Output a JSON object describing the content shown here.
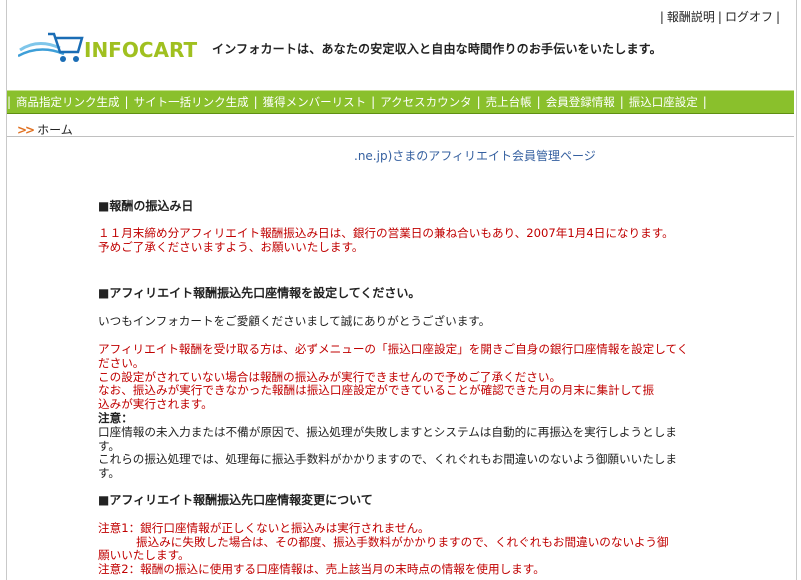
{
  "topnav": {
    "help": "報酬説明",
    "logout": "ログオフ"
  },
  "logo": {
    "text": "INFOCART"
  },
  "tagline": "インフォカートは、あなたの安定収入と自由な時間作りのお手伝いをいたします。",
  "menu": [
    "商品指定リンク生成",
    "サイト一括リンク生成",
    "獲得メンバーリスト",
    "アクセスカウンタ",
    "売上台帳",
    "会員登録情報",
    "振込口座設定"
  ],
  "breadcrumb": {
    "home": "ホーム"
  },
  "member_title": ".ne.jp)さまのアフィリエイト会員管理ページ",
  "section1": {
    "heading": "■報酬の振込み日",
    "line1": "１１月末締め分アフィリエイト報酬振込み日は、銀行の営業日の兼ね合いもあり、2007年1月4日になります。",
    "line2": "予めご了承くださいますよう、お願いいたします。"
  },
  "section2": {
    "heading": "■アフィリエイト報酬振込先口座情報を設定してください。",
    "greeting": "いつもインフォカートをご愛顧くださいまして誠にありがとうございます。",
    "red1": "アフィリエイト報酬を受け取る方は、必ずメニューの「振込口座設定」を開きご自身の銀行口座情報を設定してく",
    "red1b": "ださい。",
    "red2": "この設定がされていない場合は報酬の振込みが実行できませんので予めご了承ください。",
    "red3": "なお、振込みが実行できなかった報酬は振込口座設定ができていることが確認できた月の月末に集計して振",
    "red3b": "込みが実行されます。",
    "note_label": "注意：",
    "note1": "口座情報の未入力または不備が原因で、振込処理が失敗しますとシステムは自動的に再振込を実行しようとしま",
    "note1b": "す。",
    "note2": "これらの振込処理では、処理毎に振込手数料がかかりますので、くれぐれもお間違いのないよう御願いいたしま",
    "note2b": "す。"
  },
  "section3": {
    "heading": "■アフィリエイト報酬振込先口座情報変更について",
    "c1": "注意1：銀行口座情報が正しくないと振込みは実行されません。",
    "c1b": "振込みに失敗した場合は、その都度、振込手数料がかかりますので、くれぐれもお間違いのないよう御",
    "c1c": "願いいたします。",
    "c2": "注意2：報酬の振込に使用する口座情報は、売上該当月の末時点の情報を使用します。"
  }
}
